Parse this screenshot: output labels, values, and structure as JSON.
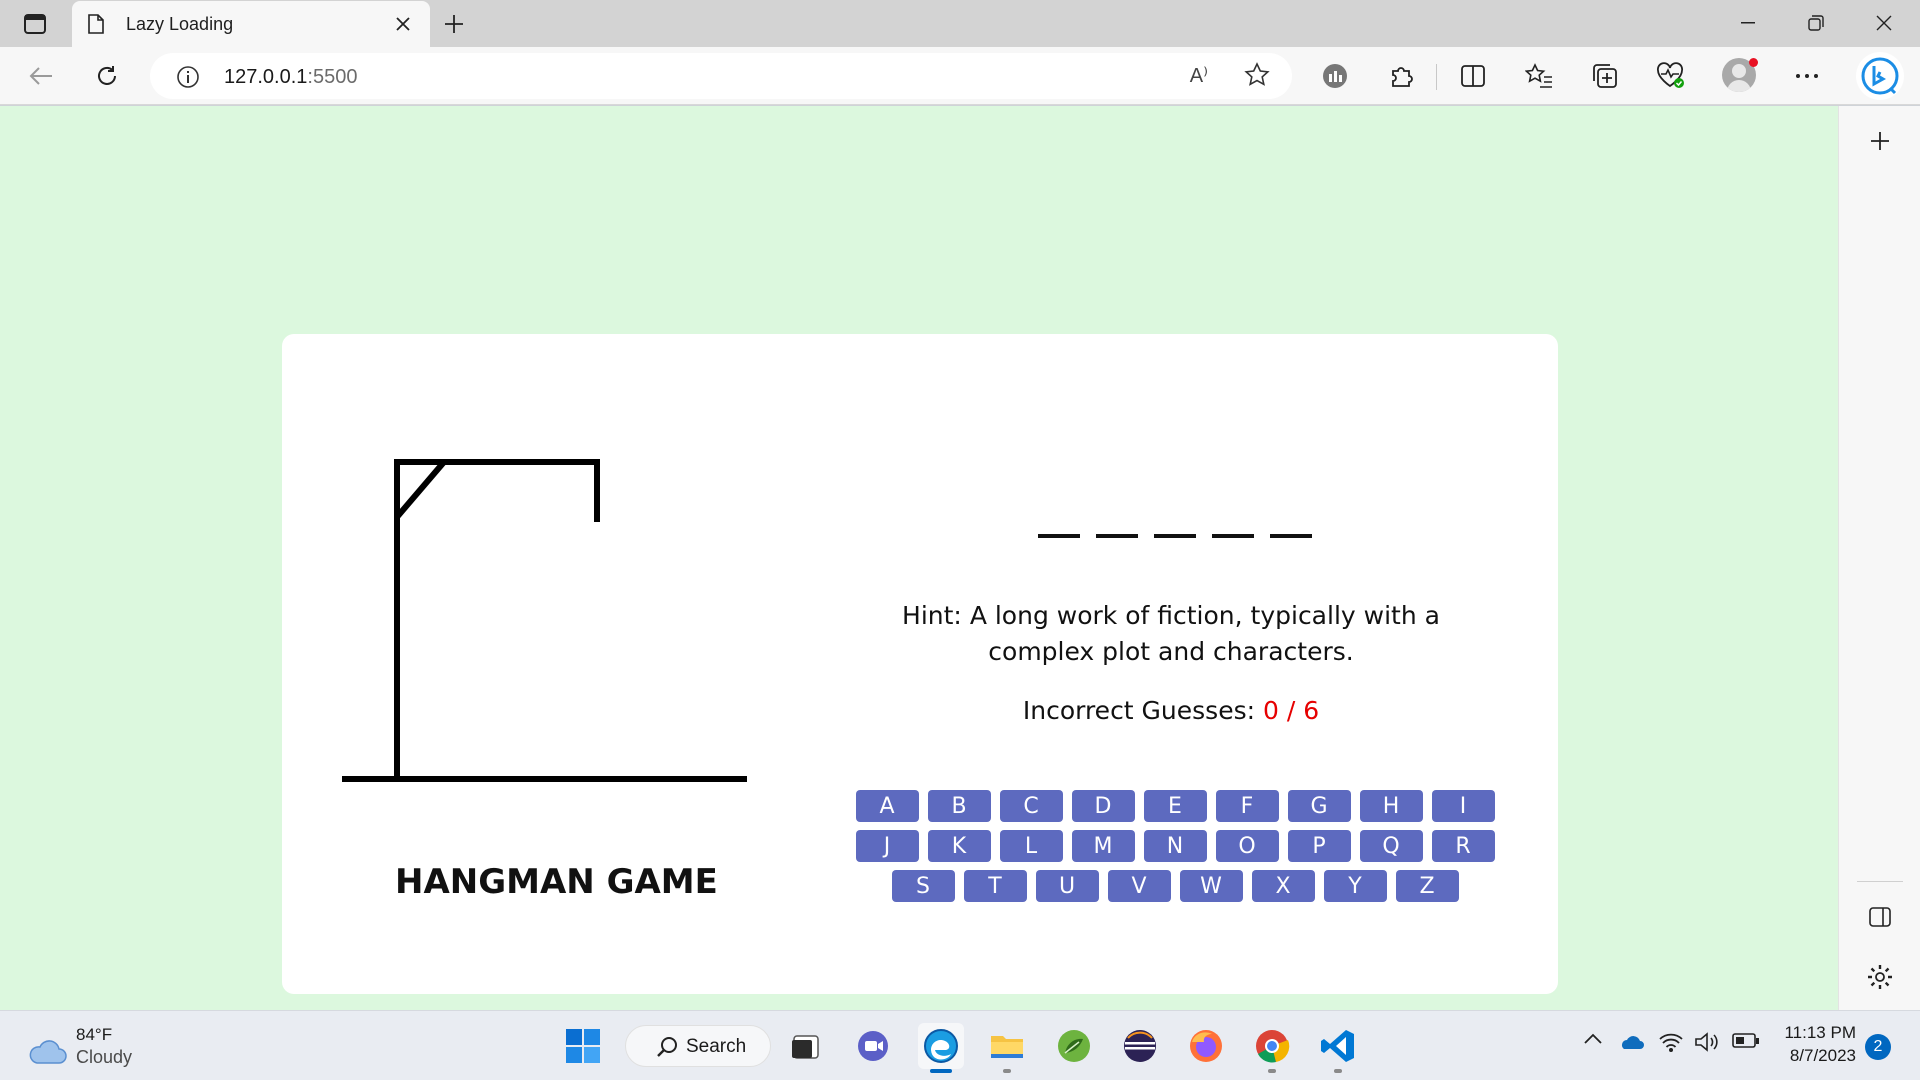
{
  "browser": {
    "tab_title": "Lazy Loading",
    "url_host": "127.0.0.1",
    "url_port": ":5500",
    "read_aloud": "A⁾"
  },
  "game": {
    "title": "HANGMAN GAME",
    "word_blanks": 5,
    "hint_label": "Hint:",
    "hint_text": "A long work of fiction, typically with a complex plot and characters.",
    "guesses_label": "Incorrect Guesses:",
    "guesses_value": "0 / 6",
    "keyboard_rows": [
      [
        "A",
        "B",
        "C",
        "D",
        "E",
        "F",
        "G",
        "H",
        "I"
      ],
      [
        "J",
        "K",
        "L",
        "M",
        "N",
        "O",
        "P",
        "Q",
        "R"
      ],
      [
        "S",
        "T",
        "U",
        "V",
        "W",
        "X",
        "Y",
        "Z"
      ]
    ],
    "colors": {
      "background": "#dcf8de",
      "key": "#5d6abf",
      "guesses_count": "#e60000"
    }
  },
  "taskbar": {
    "weather_temp": "84°F",
    "weather_cond": "Cloudy",
    "search_label": "Search",
    "time": "11:13 PM",
    "date": "8/7/2023",
    "notifications": "2"
  }
}
